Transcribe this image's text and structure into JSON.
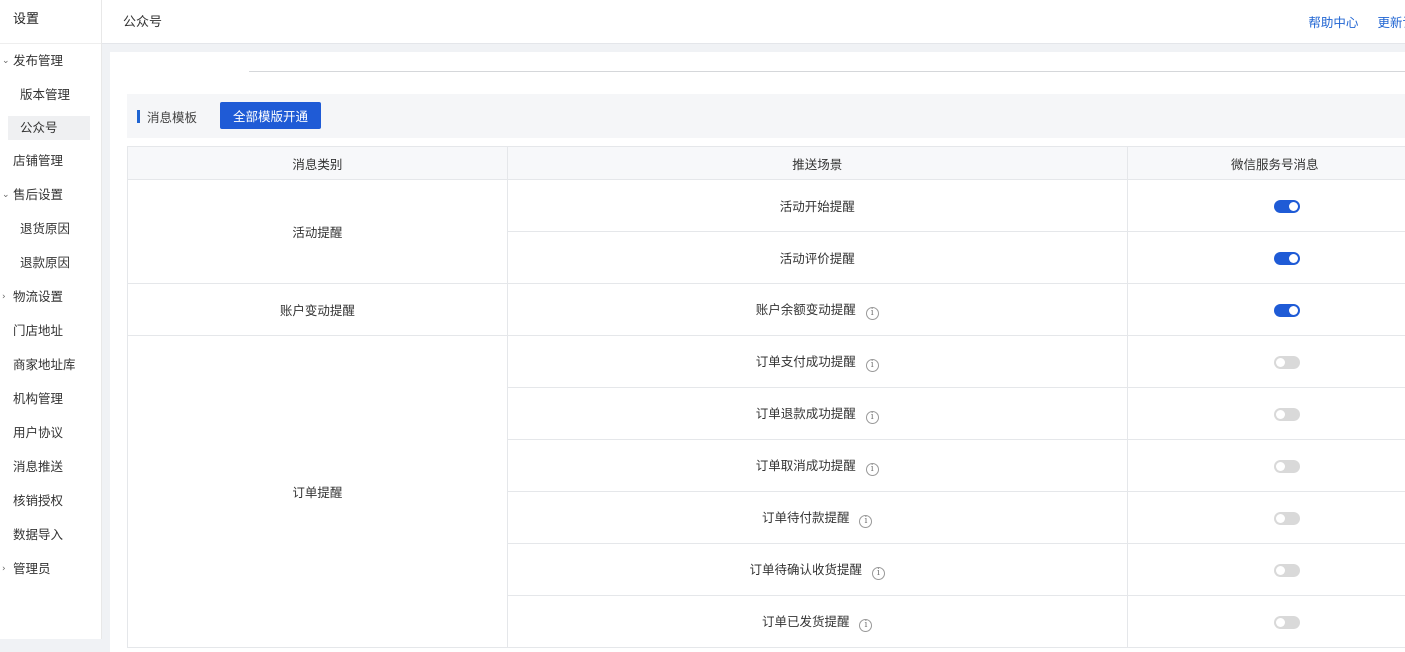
{
  "sidebar": {
    "title": "设置",
    "items": [
      {
        "label": "发布管理",
        "type": "group",
        "expanded": true
      },
      {
        "label": "版本管理",
        "type": "sub"
      },
      {
        "label": "公众号",
        "type": "sub",
        "active": true
      },
      {
        "label": "店铺管理",
        "type": "item"
      },
      {
        "label": "售后设置",
        "type": "group",
        "expanded": true
      },
      {
        "label": "退货原因",
        "type": "sub"
      },
      {
        "label": "退款原因",
        "type": "sub"
      },
      {
        "label": "物流设置",
        "type": "group",
        "expanded": false
      },
      {
        "label": "门店地址",
        "type": "item"
      },
      {
        "label": "商家地址库",
        "type": "item"
      },
      {
        "label": "机构管理",
        "type": "item"
      },
      {
        "label": "用户协议",
        "type": "item"
      },
      {
        "label": "消息推送",
        "type": "item"
      },
      {
        "label": "核销授权",
        "type": "item"
      },
      {
        "label": "数据导入",
        "type": "item"
      },
      {
        "label": "管理员",
        "type": "group",
        "expanded": false
      }
    ]
  },
  "header": {
    "title": "公众号",
    "help_link": "帮助中心",
    "changelog_link": "更新记"
  },
  "toolbar": {
    "section_title": "消息模板",
    "enable_all_button": "全部模版开通"
  },
  "table": {
    "columns": [
      "消息类别",
      "推送场景",
      "微信服务号消息"
    ],
    "groups": [
      {
        "category": "活动提醒",
        "rows": [
          {
            "scene": "活动开始提醒",
            "info": false,
            "enabled": true
          },
          {
            "scene": "活动评价提醒",
            "info": false,
            "enabled": true
          }
        ]
      },
      {
        "category": "账户变动提醒",
        "rows": [
          {
            "scene": "账户余额变动提醒",
            "info": true,
            "enabled": true
          }
        ]
      },
      {
        "category": "订单提醒",
        "rows": [
          {
            "scene": "订单支付成功提醒",
            "info": true,
            "enabled": false
          },
          {
            "scene": "订单退款成功提醒",
            "info": true,
            "enabled": false
          },
          {
            "scene": "订单取消成功提醒",
            "info": true,
            "enabled": false
          },
          {
            "scene": "订单待付款提醒",
            "info": true,
            "enabled": false
          },
          {
            "scene": "订单待确认收货提醒",
            "info": true,
            "enabled": false
          },
          {
            "scene": "订单已发货提醒",
            "info": true,
            "enabled": false
          }
        ]
      }
    ]
  },
  "icons": {
    "info": "info-icon",
    "expanded_caret": "chevron-down-icon",
    "collapsed_caret": "chevron-right-icon"
  },
  "colors": {
    "accent": "#1f5bd6",
    "link": "#1f64d2",
    "switch_off": "#d9d9d9"
  }
}
